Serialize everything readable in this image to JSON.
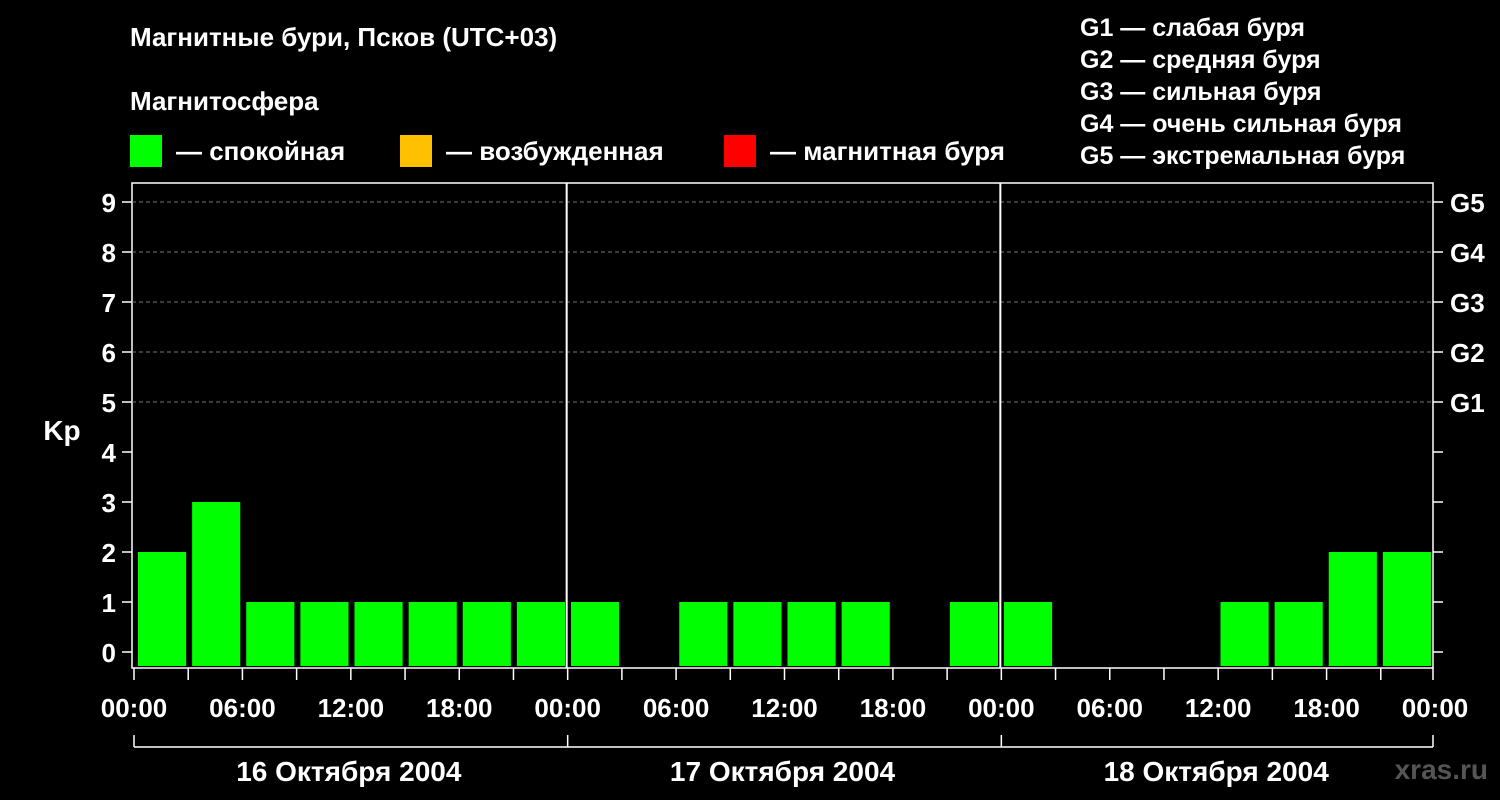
{
  "title": "Магнитные бури, Псков (UTC+03)",
  "subtitle": "Магнитосфера",
  "legend": [
    {
      "label": "— спокойная",
      "color": "#00ff00"
    },
    {
      "label": "— возбужденная",
      "color": "#ffc000"
    },
    {
      "label": "— магнитная буря",
      "color": "#ff0000"
    }
  ],
  "storm_levels": [
    "G1 — слабая буря",
    "G2 — средняя буря",
    "G3 — сильная буря",
    "G4 — очень сильная буря",
    "G5 — экстремальная буря"
  ],
  "watermark": "xras.ru",
  "chart_data": {
    "type": "bar",
    "title": "Магнитные бури, Псков (UTC+03)",
    "ylabel": "Kp",
    "ylim": [
      0,
      9
    ],
    "yticks": [
      "0",
      "1",
      "2",
      "3",
      "4",
      "5",
      "6",
      "7",
      "8",
      "9"
    ],
    "right_ticks": [
      {
        "value": 5,
        "label": "G1"
      },
      {
        "value": 6,
        "label": "G2"
      },
      {
        "value": 7,
        "label": "G3"
      },
      {
        "value": 8,
        "label": "G4"
      },
      {
        "value": 9,
        "label": "G5"
      }
    ],
    "xtick_labels": [
      "00:00",
      "06:00",
      "12:00",
      "18:00",
      "00:00",
      "06:00",
      "12:00",
      "18:00",
      "00:00",
      "06:00",
      "12:00",
      "18:00",
      "00:00"
    ],
    "days": [
      "16 Октября 2004",
      "17 Октября 2004",
      "18 Октября 2004"
    ],
    "interval_hours": 3,
    "values": [
      2,
      3,
      1,
      1,
      1,
      1,
      1,
      1,
      1,
      0,
      1,
      1,
      1,
      1,
      0,
      1,
      1,
      0,
      0,
      0,
      1,
      1,
      2,
      2
    ],
    "bar_color": "#00ff00",
    "grid": true
  }
}
